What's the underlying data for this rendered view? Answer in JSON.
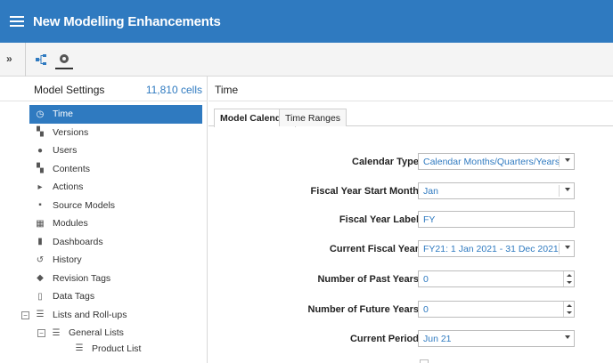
{
  "app": {
    "title": "New Modelling Enhancements"
  },
  "toolbar": {
    "expand_icon": "double-chevron-right-icon",
    "expand_glyph": "»"
  },
  "left": {
    "header": "Model Settings",
    "cells": "11,810 cells",
    "items": [
      {
        "label": "Time",
        "icon": "clock-icon",
        "glyph": "◷"
      },
      {
        "label": "Versions",
        "icon": "versions-icon",
        "glyph": "▚"
      },
      {
        "label": "Users",
        "icon": "user-icon",
        "glyph": "●"
      },
      {
        "label": "Contents",
        "icon": "contents-icon",
        "glyph": "▚"
      },
      {
        "label": "Actions",
        "icon": "actions-icon",
        "glyph": "▸"
      },
      {
        "label": "Source Models",
        "icon": "source-models-icon",
        "glyph": "▪"
      },
      {
        "label": "Modules",
        "icon": "modules-icon",
        "glyph": "▦"
      },
      {
        "label": "Dashboards",
        "icon": "dashboard-icon",
        "glyph": "▮"
      },
      {
        "label": "History",
        "icon": "history-icon",
        "glyph": "↺"
      },
      {
        "label": "Revision Tags",
        "icon": "tag-icon",
        "glyph": "◆"
      },
      {
        "label": "Data Tags",
        "icon": "data-tag-icon",
        "glyph": "▯"
      },
      {
        "label": "Lists and Roll-ups",
        "icon": "list-icon",
        "glyph": "☰"
      },
      {
        "label": "General Lists",
        "icon": "list-icon",
        "glyph": "☰"
      },
      {
        "label": "Product List",
        "icon": "list-icon",
        "glyph": "☰"
      }
    ]
  },
  "right": {
    "title": "Time",
    "tabs": [
      "Model Calendar",
      "Time Ranges"
    ],
    "fields": [
      {
        "label": "Calendar Type",
        "value": "Calendar Months/Quarters/Years"
      },
      {
        "label": "Fiscal Year Start Month",
        "value": "Jan"
      },
      {
        "label": "Fiscal Year Label",
        "value": "FY"
      },
      {
        "label": "Current Fiscal Year",
        "value": "FY21: 1 Jan 2021 - 31 Dec 2021"
      },
      {
        "label": "Number of Past Years",
        "value": "0"
      },
      {
        "label": "Number of Future Years",
        "value": "0"
      },
      {
        "label": "Current Period",
        "value": "Jun 21"
      }
    ]
  },
  "colors": {
    "brand": "#2f7ac0",
    "selected": "#2f7ac0"
  }
}
